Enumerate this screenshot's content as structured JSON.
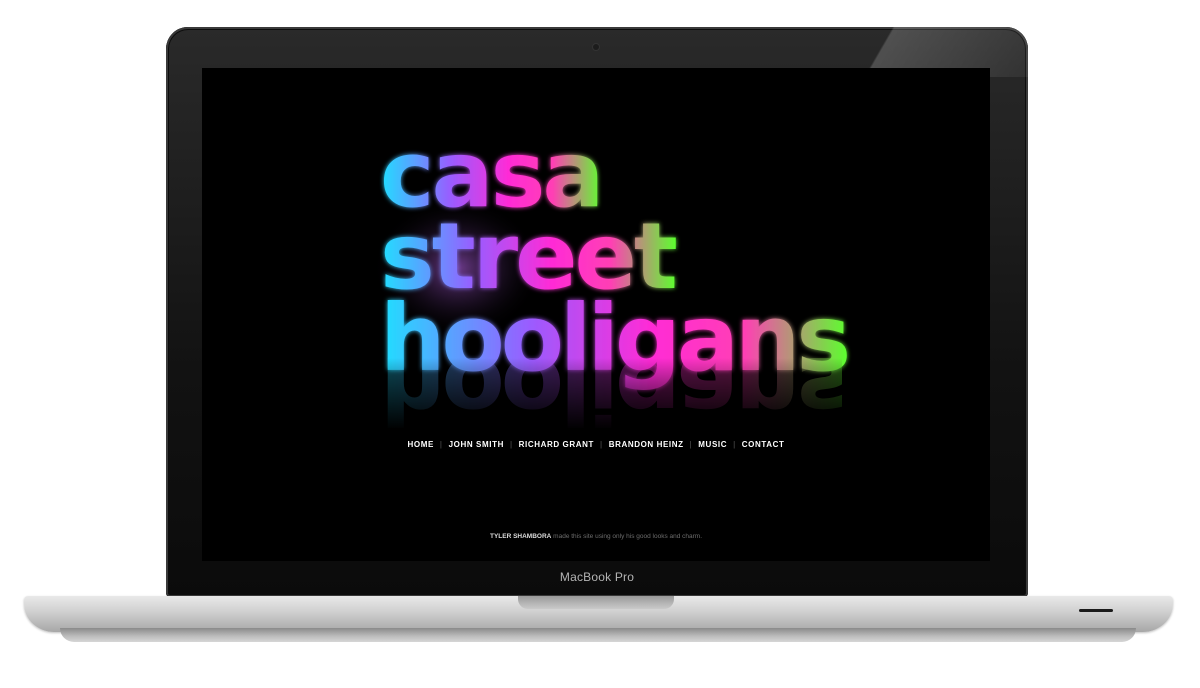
{
  "device": {
    "label": "MacBook Pro"
  },
  "site": {
    "logo": {
      "lines": [
        "casa",
        "street",
        "hooligans"
      ]
    },
    "nav": {
      "items": [
        "HOME",
        "JOHN SMITH",
        "RICHARD GRANT",
        "BRANDON HEINZ",
        "MUSIC",
        "CONTACT"
      ],
      "separator": "|"
    },
    "credit": {
      "name": "TYLER SHAMBORA",
      "text": "made this site using only his good looks and charm."
    }
  },
  "colors": {
    "screen_bg": "#000000",
    "logo_gradient": [
      "#1fe0ff",
      "#9a5cff",
      "#ff2bd6",
      "#ff3fb4",
      "#5cff2e"
    ],
    "nav_text": "#ffffff",
    "credit_text": "#6d6d6d"
  }
}
